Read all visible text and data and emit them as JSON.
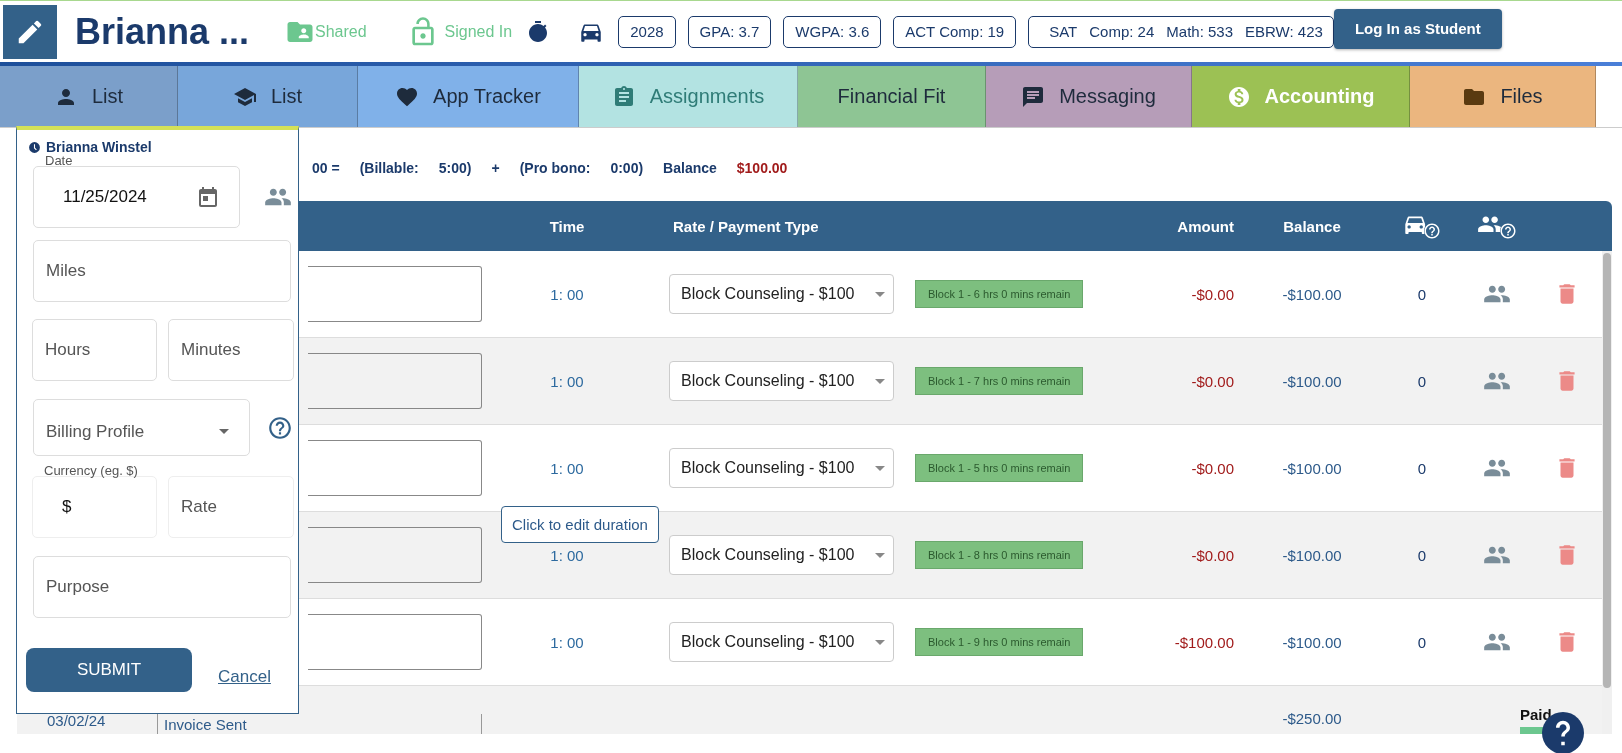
{
  "header": {
    "student_name": "Brianna ...",
    "shared": "Shared",
    "signed_in": "Signed In",
    "badges": [
      "2028",
      "GPA: 3.7",
      "WGPA: 3.6",
      "ACT Comp: 19"
    ],
    "sat": [
      "SAT",
      "Comp: 24",
      "Math: 533",
      "EBRW: 423"
    ],
    "login_button": "Log In as Student"
  },
  "tabs": [
    {
      "label": "List",
      "kind": "person",
      "color": "#7b9fca",
      "selected": false
    },
    {
      "label": "List",
      "kind": "cap",
      "color": "#78a6da",
      "selected": false
    },
    {
      "label": "App Tracker",
      "kind": "heart",
      "color": "#80b1e9",
      "selected": false
    },
    {
      "label": "Assignments",
      "kind": "clipboard",
      "color": "#b3e3e2",
      "selected": false
    },
    {
      "label": "Financial Fit",
      "kind": "plain",
      "color": "#8ec594",
      "selected": false
    },
    {
      "label": "Messaging",
      "kind": "chat",
      "color": "#b69db8",
      "selected": false
    },
    {
      "label": "Accounting",
      "kind": "dollar",
      "color": "#9cc154",
      "selected": true
    },
    {
      "label": "Files",
      "kind": "folder",
      "color": "#ebb67f",
      "selected": false
    }
  ],
  "summary": [
    {
      "text": "00 =",
      "kind": "text"
    },
    {
      "text": "(Billable:",
      "kind": "text"
    },
    {
      "text": "5:00)",
      "kind": "text"
    },
    {
      "text": "+",
      "kind": "text"
    },
    {
      "text": "(Pro bono:",
      "kind": "text"
    },
    {
      "text": "0:00)",
      "kind": "text"
    },
    {
      "text": "Balance",
      "kind": "text"
    },
    {
      "text": "$100.00",
      "kind": "money"
    }
  ],
  "table": {
    "columns": [
      "Time",
      "Rate / Payment Type",
      "Amount",
      "Balance"
    ],
    "rows": [
      {
        "time": "1: 00",
        "rate": "Block Counseling - $100",
        "block": "Block 1 - 6 hrs 0 mins remain",
        "amount": "-$0.00",
        "balance": "-$100.00",
        "miles": "0"
      },
      {
        "time": "1: 00",
        "rate": "Block Counseling - $100",
        "block": "Block 1 - 7 hrs 0 mins remain",
        "amount": "-$0.00",
        "balance": "-$100.00",
        "miles": "0"
      },
      {
        "time": "1: 00",
        "rate": "Block Counseling - $100",
        "block": "Block 1 - 5 hrs 0 mins remain",
        "amount": "-$0.00",
        "balance": "-$100.00",
        "miles": "0"
      },
      {
        "time": "1: 00",
        "rate": "Block Counseling - $100",
        "block": "Block 1 - 8 hrs 0 mins remain",
        "amount": "-$0.00",
        "balance": "-$100.00",
        "miles": "0"
      },
      {
        "time": "1: 00",
        "rate": "Block Counseling - $100",
        "block": "Block 1 - 9 hrs 0 mins remain",
        "amount": "-$100.00",
        "balance": "-$100.00",
        "miles": "0"
      }
    ],
    "invoice_row": {
      "date": "03/02/24",
      "description": "Invoice Sent",
      "balance": "-$250.00",
      "status": "Paid"
    }
  },
  "tooltip": "Click to edit duration",
  "panel": {
    "title": "Brianna Winstel",
    "date_label": "Date",
    "date_value": "11/25/2024",
    "miles": {
      "placeholder": "Miles"
    },
    "hours": {
      "placeholder": "Hours"
    },
    "minutes": {
      "placeholder": "Minutes"
    },
    "billing_profile": {
      "placeholder": "Billing Profile"
    },
    "currency_label": "Currency (eg. $)",
    "currency_value": "$",
    "rate": {
      "placeholder": "Rate"
    },
    "purpose": {
      "placeholder": "Purpose"
    },
    "submit": "SUBMIT",
    "cancel": "Cancel"
  }
}
